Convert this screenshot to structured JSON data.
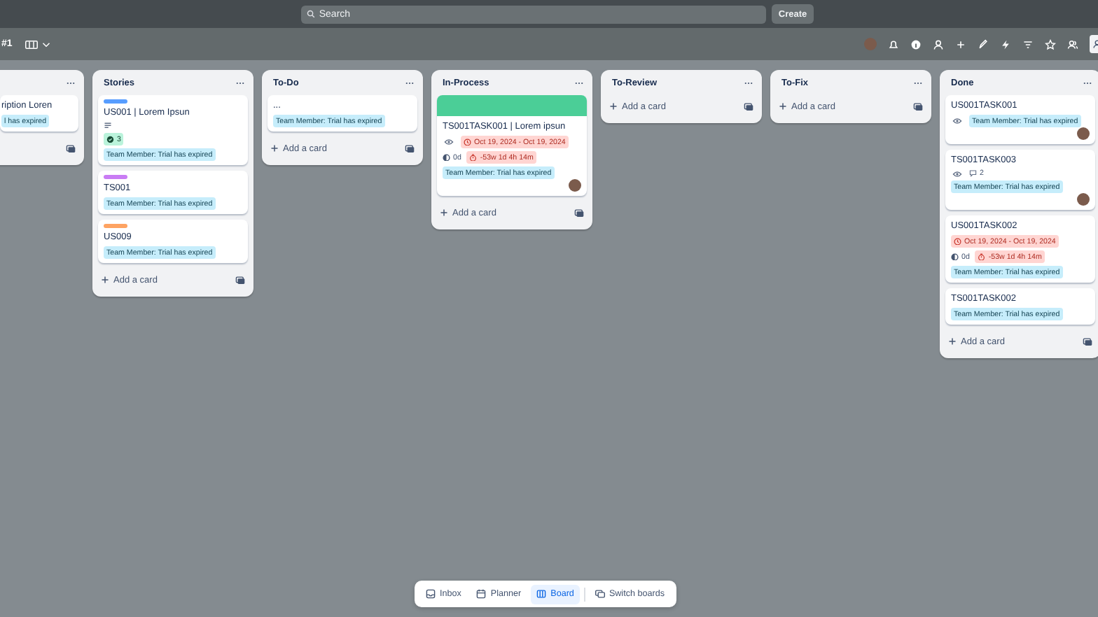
{
  "topbar": {
    "search": {
      "placeholder": "Search"
    },
    "create_button": "Create"
  },
  "board_header": {
    "board_name": "#1"
  },
  "lists": [
    {
      "cards": [
        {
          "title": "ription Loren",
          "rows": [
            [
              {
                "kind": "tag",
                "text": "l has expired"
              }
            ]
          ],
          "member": false
        }
      ]
    },
    {
      "title": "Stories",
      "add_card": "Add a card",
      "cards": [
        {
          "label": {
            "color": "#579dff"
          },
          "title": "US001 | Lorem Ipsun",
          "rows": [
            [
              {
                "kind": "description"
              }
            ],
            [
              {
                "kind": "checklist",
                "text": "3"
              }
            ],
            [
              {
                "kind": "tag",
                "text": "Team Member: Trial has expired"
              }
            ]
          ],
          "member": false
        },
        {
          "label": {
            "color": "#c97cf4"
          },
          "title": "TS001",
          "rows": [
            [
              {
                "kind": "tag",
                "text": "Team Member: Trial has expired"
              }
            ]
          ],
          "member": false
        },
        {
          "label": {
            "color": "#fea362"
          },
          "title": "US009",
          "rows": [
            [
              {
                "kind": "tag",
                "text": "Team Member: Trial has expired"
              }
            ]
          ],
          "member": false
        }
      ]
    },
    {
      "title": "To-Do",
      "add_card": "Add a card",
      "cards": [
        {
          "title": "...",
          "rows": [
            [
              {
                "kind": "tag",
                "text": "Team Member: Trial has expired"
              }
            ]
          ],
          "member": false
        }
      ]
    },
    {
      "title": "In-Process",
      "add_card": "Add a card",
      "cards": [
        {
          "cover": {
            "color": "#4bce97"
          },
          "title": "TS001TASK001 | Lorem ipsun",
          "rows": [
            [
              {
                "kind": "watch"
              },
              {
                "kind": "dates",
                "text": "Oct 19, 2024 - Oct 19, 2024"
              }
            ],
            [
              {
                "kind": "progress",
                "text": "0d"
              },
              {
                "kind": "timer",
                "text": "-53w 1d 4h 14m"
              }
            ],
            [
              {
                "kind": "tag",
                "text": "Team Member: Trial has expired"
              }
            ]
          ],
          "member": true
        }
      ]
    },
    {
      "title": "To-Review",
      "add_card": "Add a card"
    },
    {
      "title": "To-Fix",
      "add_card": "Add a card"
    },
    {
      "title": "Done",
      "add_card": "Add a card",
      "cards": [
        {
          "title": "US001TASK001",
          "rows": [
            [
              {
                "kind": "watch"
              },
              {
                "kind": "tag",
                "text": "Team Member: Trial has expired"
              }
            ]
          ],
          "member": true
        },
        {
          "title": "TS001TASK003",
          "rows": [
            [
              {
                "kind": "watch"
              },
              {
                "kind": "comments",
                "text": "2"
              }
            ],
            [
              {
                "kind": "tag",
                "text": "Team Member: Trial has expired"
              }
            ]
          ],
          "member": true
        },
        {
          "title": "US001TASK002",
          "rows": [
            [
              {
                "kind": "dates",
                "text": "Oct 19, 2024 - Oct 19, 2024"
              }
            ],
            [
              {
                "kind": "progress",
                "text": "0d"
              },
              {
                "kind": "timer",
                "text": "-53w 1d 4h 14m"
              }
            ],
            [
              {
                "kind": "tag",
                "text": "Team Member: Trial has expired"
              }
            ]
          ],
          "member": false
        },
        {
          "title": "TS001TASK002",
          "rows": [
            [
              {
                "kind": "tag",
                "text": "Team Member: Trial has expired"
              }
            ]
          ],
          "member": false
        }
      ]
    }
  ],
  "bottom_nav": [
    {
      "kind": "inbox",
      "label": "Inbox",
      "selected": false
    },
    {
      "kind": "planner",
      "label": "Planner",
      "selected": false
    },
    {
      "kind": "board",
      "label": "Board",
      "selected": true
    },
    {
      "kind": "switch",
      "label": "Switch boards",
      "selected": false
    }
  ]
}
